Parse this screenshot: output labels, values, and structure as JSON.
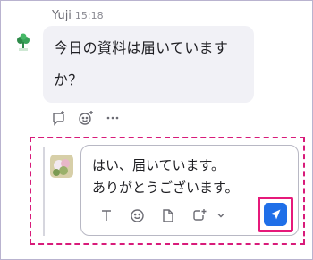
{
  "message": {
    "sender": "Yuji",
    "time": "15:18",
    "text_line1": "今日の資料は届いていますか",
    "text_line2": "か？"
  },
  "message_actions": [
    "reply-icon",
    "add-reaction-icon",
    "more-icon"
  ],
  "composer": {
    "line1": "はい、届いています。",
    "line2": "ありがとうございます。"
  },
  "toolbar": [
    "text-format-icon",
    "emoji-icon",
    "file-icon",
    "screenshot-icon",
    "chevron-down-icon"
  ],
  "send_button": "send-icon",
  "colors": {
    "bubble": "#f1f1f6",
    "send": "#1f6fe8",
    "highlight": "#e6197a",
    "dash": "#d81b7a"
  }
}
